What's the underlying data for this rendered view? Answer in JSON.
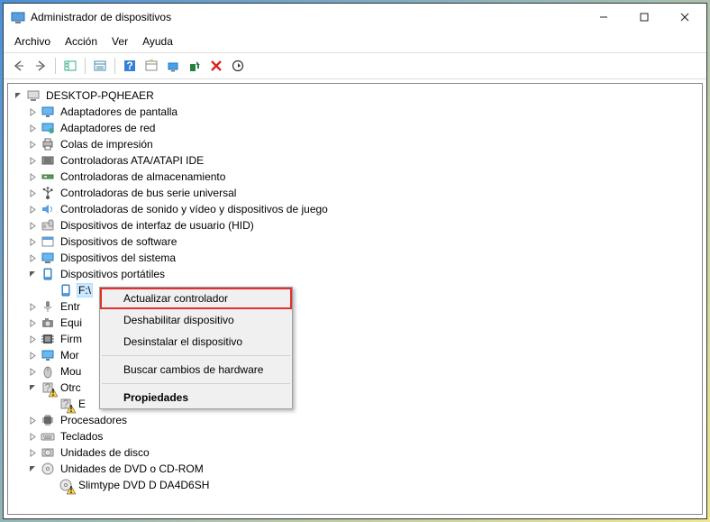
{
  "title": "Administrador de dispositivos",
  "menubar": {
    "file": "Archivo",
    "action": "Acción",
    "view": "Ver",
    "help": "Ayuda"
  },
  "root": "DESKTOP-PQHEAER",
  "categories": {
    "display": "Adaptadores de pantalla",
    "network": "Adaptadores de red",
    "printq": "Colas de impresión",
    "ata": "Controladoras ATA/ATAPI IDE",
    "storage": "Controladoras de almacenamiento",
    "usb": "Controladoras de bus serie universal",
    "sound": "Controladoras de sonido y vídeo y dispositivos de juego",
    "hid": "Dispositivos de interfaz de usuario (HID)",
    "software": "Dispositivos de software",
    "system": "Dispositivos del sistema",
    "portable": "Dispositivos portátiles",
    "portable_item": "F:\\",
    "input": "Entr",
    "imaging": "Equi",
    "firmware": "Firm",
    "monitor": "Mor",
    "mouse": "Mou",
    "other": "Otrc",
    "other_item": "E",
    "processors": "Procesadores",
    "keyboards": "Teclados",
    "disk": "Unidades de disco",
    "dvd": "Unidades de DVD o CD-ROM",
    "dvd_item": "Slimtype DVD D  DA4D6SH"
  },
  "context": {
    "update": "Actualizar controlador",
    "disable": "Deshabilitar dispositivo",
    "uninstall": "Desinstalar el dispositivo",
    "scan": "Buscar cambios de hardware",
    "props": "Propiedades"
  }
}
